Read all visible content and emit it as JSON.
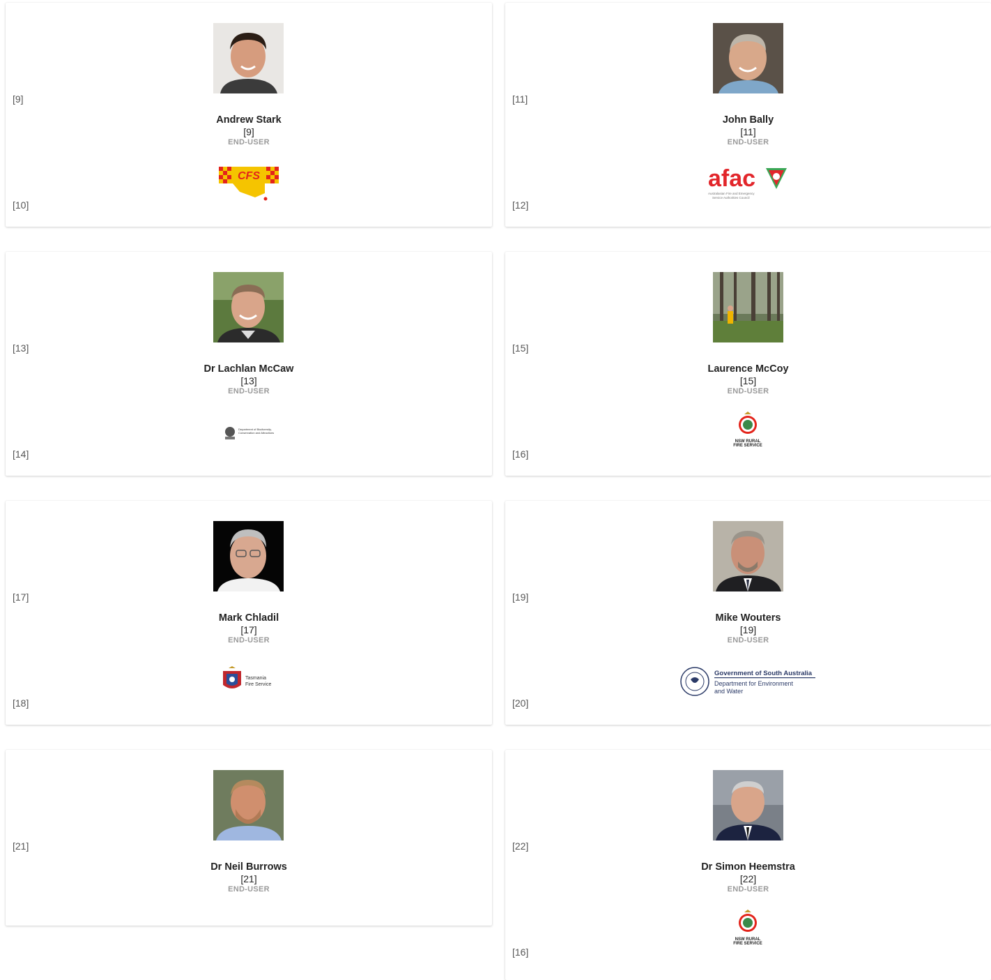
{
  "cards": [
    {
      "name": "Andrew Stark",
      "ref_top": "[9]",
      "ref_number": "[9]",
      "role": "END-USER",
      "ref_bottom": "[10]",
      "logo_text": "CFS"
    },
    {
      "name": "John Bally",
      "ref_top": "[11]",
      "ref_number": "[11]",
      "role": "END-USER",
      "ref_bottom": "[12]",
      "logo_text": "afac",
      "logo_sub1": "Australasian Fire and Emergency",
      "logo_sub2": "Service Authorities Council"
    },
    {
      "name": "Dr Lachlan McCaw",
      "ref_top": "[13]",
      "ref_number": "[13]",
      "role": "END-USER",
      "ref_bottom": "[14]",
      "logo_sub1": "Department of Biodiversity,",
      "logo_sub2": "Conservation and Attractions"
    },
    {
      "name": "Laurence McCoy",
      "ref_top": "[15]",
      "ref_number": "[15]",
      "role": "END-USER",
      "ref_bottom": "[16]",
      "logo_sub1": "NSW RURAL",
      "logo_sub2": "FIRE SERVICE"
    },
    {
      "name": "Mark Chladil",
      "ref_top": "[17]",
      "ref_number": "[17]",
      "role": "END-USER",
      "ref_bottom": "[18]",
      "logo_sub1": "Tasmania",
      "logo_sub2": "Fire Service"
    },
    {
      "name": "Mike Wouters",
      "ref_top": "[19]",
      "ref_number": "[19]",
      "role": "END-USER",
      "ref_bottom": "[20]",
      "logo_text": "Government of South Australia",
      "logo_sub1": "Department for Environment",
      "logo_sub2": "and Water"
    },
    {
      "name": "Dr Neil Burrows",
      "ref_top": "[21]",
      "ref_number": "[21]",
      "role": "END-USER",
      "ref_bottom": ""
    },
    {
      "name": "Dr Simon Heemstra",
      "ref_top": "[22]",
      "ref_number": "[22]",
      "role": "END-USER",
      "ref_bottom": "[16]",
      "logo_sub1": "NSW RURAL",
      "logo_sub2": "FIRE SERVICE"
    }
  ],
  "colors": {
    "role_gray": "#9a9a9a",
    "cfs_yellow": "#f5c400",
    "cfs_red": "#e3241b",
    "afac_red": "#e2262b",
    "afac_green": "#3aa655",
    "sa_navy": "#2b3a67"
  },
  "icons": [
    "person-photo",
    "cfs-logo",
    "afac-logo",
    "dbca-logo",
    "nsw-rfs-logo",
    "tas-fire-logo",
    "sa-gov-logo"
  ]
}
